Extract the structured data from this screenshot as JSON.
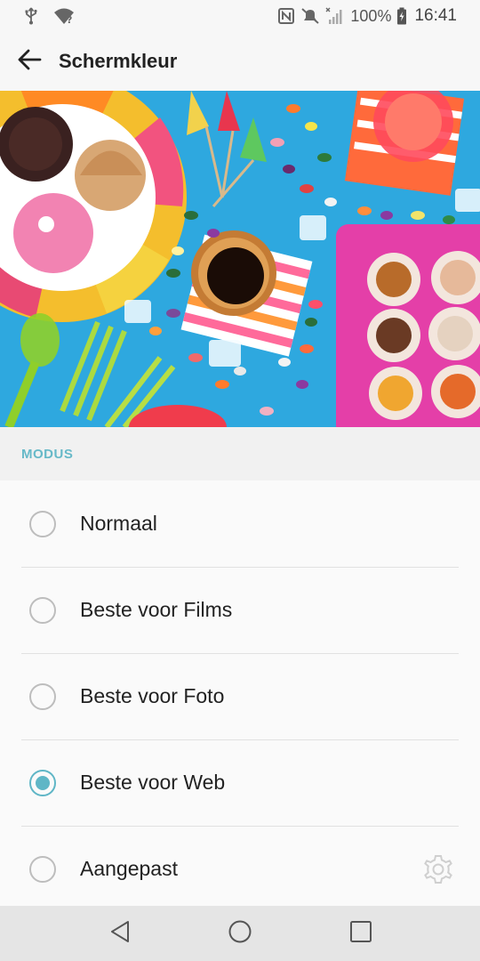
{
  "status_bar": {
    "icons": [
      "usb-icon",
      "wifi-question-icon",
      "nfc-icon",
      "mute-icon",
      "signal-icon",
      "battery-icon"
    ],
    "battery": "100%",
    "time": "16:41"
  },
  "app_bar": {
    "back_icon": "arrow-left-icon",
    "title": "Schermkleur"
  },
  "section": {
    "label": "MODUS"
  },
  "options": [
    {
      "label": "Normaal",
      "selected": false
    },
    {
      "label": "Beste voor Films",
      "selected": false
    },
    {
      "label": "Beste voor Foto",
      "selected": false
    },
    {
      "label": "Beste voor Web",
      "selected": true
    },
    {
      "label": "Aangepast",
      "selected": false,
      "settings_icon": "gear-icon"
    }
  ],
  "nav_bar": {
    "icons": [
      "back-triangle-icon",
      "home-circle-icon",
      "recents-square-icon"
    ]
  },
  "colors": {
    "accent": "#5fb6c6",
    "section_label": "#67b9c8",
    "background": "#f7f7f7"
  }
}
